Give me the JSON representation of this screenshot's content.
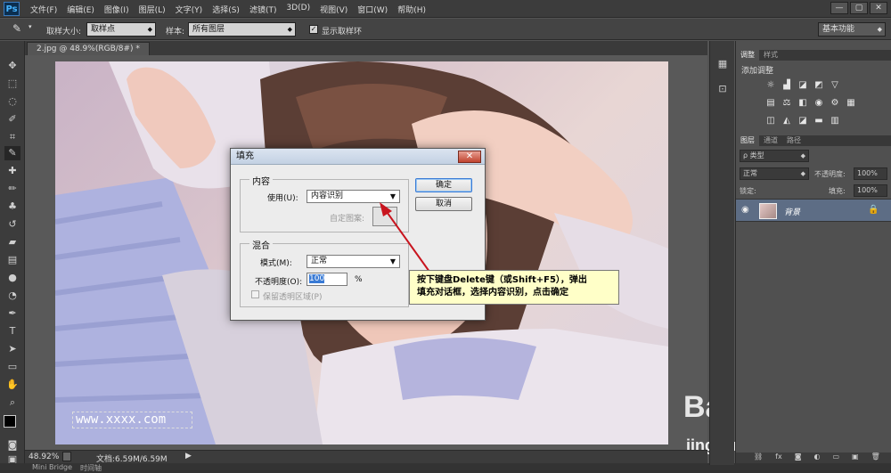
{
  "app": {
    "logo": "Ps"
  },
  "menu": [
    "文件(F)",
    "编辑(E)",
    "图像(I)",
    "图层(L)",
    "文字(Y)",
    "选择(S)",
    "滤镜(T)",
    "3D(D)",
    "视图(V)",
    "窗口(W)",
    "帮助(H)"
  ],
  "window_controls": {
    "minimize": "—",
    "restore": "▢",
    "close": "✕"
  },
  "options": {
    "sample_size_label": "取样大小:",
    "sample_size_value": "取样点",
    "sample_label": "样本:",
    "sample_value": "所有图层",
    "show_ring_label": "显示取样环",
    "show_ring_checked": true,
    "workspace": "基本功能"
  },
  "document_tab": "2.jpg @ 48.9%(RGB/8#) *",
  "status": {
    "zoom": "48.92%",
    "doc_info": "文档:6.59M/6.59M"
  },
  "bottom_tabs": [
    "Mini Bridge",
    "时间轴"
  ],
  "panels": {
    "adjustments_tabs": [
      "调整",
      "样式"
    ],
    "adjustments_title": "添加调整",
    "layers_tabs": [
      "图层",
      "通道",
      "路径"
    ],
    "filter_kind": "ρ 类型",
    "blend_mode": "正常",
    "opacity_label": "不透明度:",
    "opacity_value": "100%",
    "lock_label": "锁定:",
    "fill_label": "填充:",
    "fill_value": "100%",
    "layer_name": "背景"
  },
  "dialog": {
    "title": "填充",
    "close": "✕",
    "content_group": "内容",
    "use_label": "使用(U):",
    "use_value": "内容识别",
    "custom_pattern_label": "自定图案:",
    "blend_group": "混合",
    "mode_label": "模式(M):",
    "mode_value": "正常",
    "opacity_label": "不透明度(O):",
    "opacity_value": "100",
    "opacity_unit": "%",
    "preserve_transparency_label": "保留透明区域(P)",
    "preserve_transparency_checked": false,
    "ok_label": "确定",
    "cancel_label": "取消"
  },
  "callout": {
    "line1": "按下键盘Delete键（或Shift+F5），弹出",
    "line2": "填充对话框，选择内容识别，点击确定"
  },
  "watermark": {
    "text": "www.xxxx.com",
    "baidu_logo": "Bai du 经验",
    "baidu_url": "jingyan.baidu.com"
  },
  "colors": {
    "arrow": "#c8141e",
    "layer_selected": "#5d6d85",
    "callout_bg": "#ffffc8"
  }
}
